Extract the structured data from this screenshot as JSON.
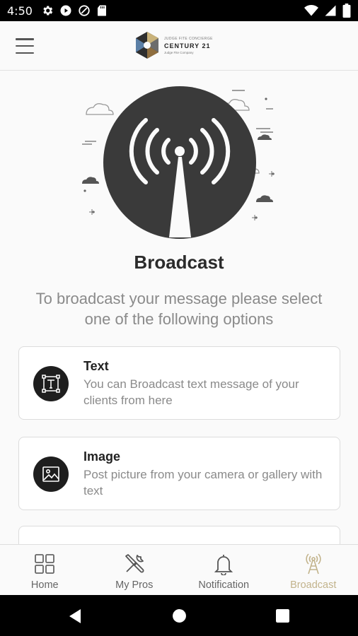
{
  "status_bar": {
    "time": "4:50",
    "icons_left": [
      "gear-icon",
      "play-icon",
      "data-saver-icon",
      "sd-card-icon"
    ],
    "icons_right": [
      "wifi-icon",
      "signal-icon",
      "battery-icon"
    ]
  },
  "app_bar": {
    "logo": {
      "line1": "JUDGE FITE CONCIERGE",
      "line2": "CENTURY 21",
      "line3": "Judge Fite Company"
    }
  },
  "main": {
    "title": "Broadcast",
    "subtitle": "To broadcast your message please select one of the following options",
    "options": [
      {
        "title": "Text",
        "description": "You can Broadcast text message of your clients from here",
        "icon": "text-icon"
      },
      {
        "title": "Image",
        "description": "Post picture from your camera or gallery with text",
        "icon": "image-icon"
      }
    ]
  },
  "bottom_nav": {
    "items": [
      {
        "label": "Home",
        "icon": "grid-icon"
      },
      {
        "label": "My Pros",
        "icon": "tools-icon"
      },
      {
        "label": "Notification",
        "icon": "bell-icon"
      },
      {
        "label": "Broadcast",
        "icon": "broadcast-tower-icon",
        "active": true
      }
    ]
  },
  "colors": {
    "accent": "#c2b38b",
    "dark": "#1e1e1e",
    "hero_circle": "#3a3a3a"
  }
}
